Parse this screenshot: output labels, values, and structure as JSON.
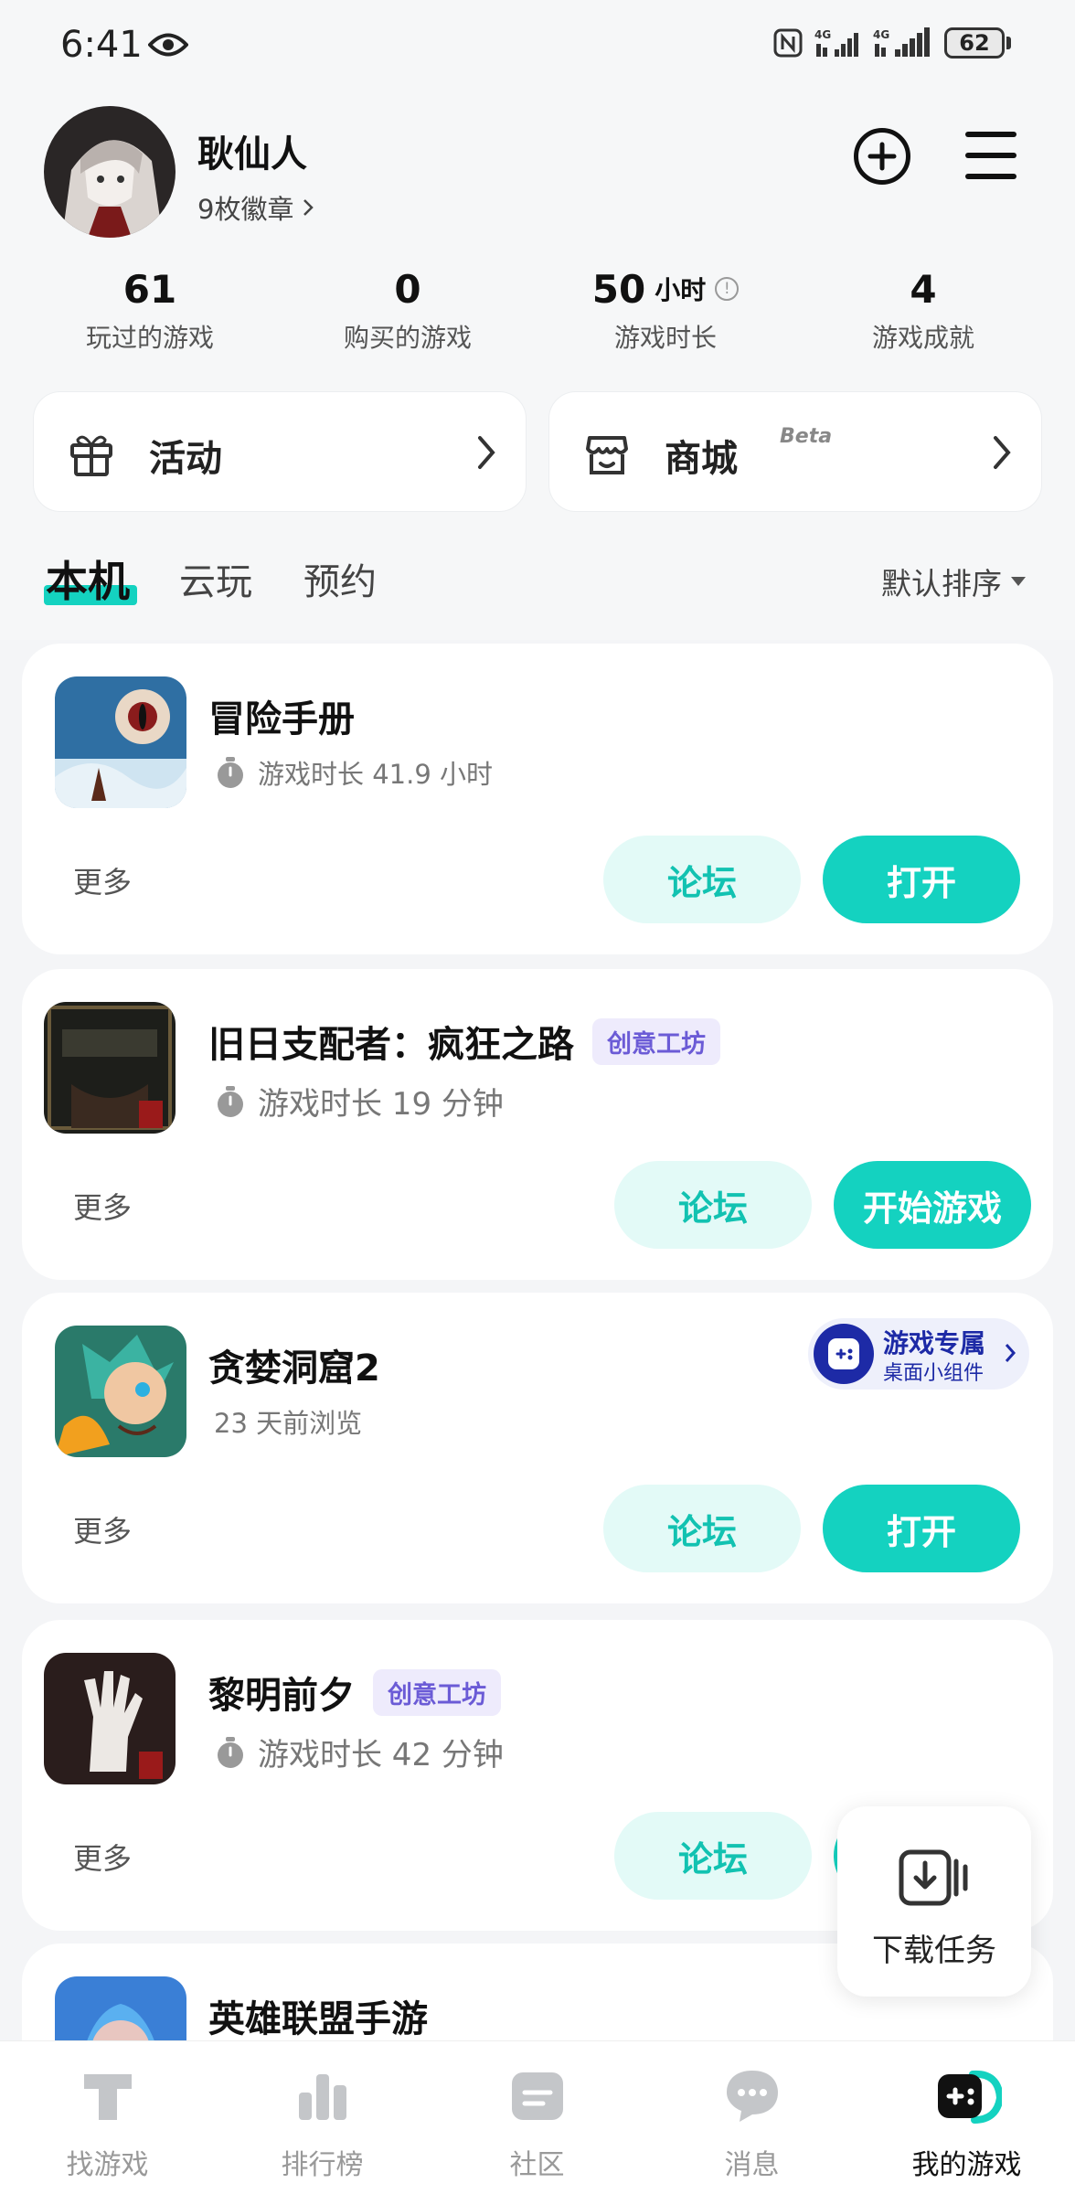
{
  "status_bar": {
    "time": "6:41",
    "battery": "62",
    "network_label": "4G"
  },
  "profile": {
    "username": "耿仙人",
    "badges": "9枚徽章"
  },
  "stats": [
    {
      "value": "61",
      "unit": "",
      "label": "玩过的游戏"
    },
    {
      "value": "0",
      "unit": "",
      "label": "购买的游戏"
    },
    {
      "value": "50",
      "unit": "小时",
      "label": "游戏时长"
    },
    {
      "value": "4",
      "unit": "",
      "label": "游戏成就"
    }
  ],
  "quick": {
    "activity": "活动",
    "store": "商城",
    "beta": "Beta"
  },
  "tabs": [
    "本机",
    "云玩",
    "预约"
  ],
  "sort": "默认排序",
  "games": [
    {
      "title": "冒险手册",
      "tag": "",
      "sub": "游戏时长 41.9 小时",
      "more": "更多",
      "forum": "论坛",
      "action": "打开"
    },
    {
      "title": "旧日支配者：疯狂之路",
      "tag": "创意工坊",
      "sub": "游戏时长 19 分钟",
      "more": "更多",
      "forum": "论坛",
      "action": "开始游戏"
    },
    {
      "title": "贪婪洞窟2",
      "tag": "",
      "sub": "23 天前浏览",
      "more": "更多",
      "forum": "论坛",
      "action": "打开",
      "promo": {
        "title": "游戏专属",
        "sub": "桌面小组件"
      }
    },
    {
      "title": "黎明前夕",
      "tag": "创意工坊",
      "sub": "游戏时长 42 分钟",
      "more": "更多",
      "forum": "论坛",
      "action": ""
    },
    {
      "title": "英雄联盟手游",
      "tag": "",
      "sub": "",
      "more": "",
      "forum": "",
      "action": ""
    }
  ],
  "download_float": {
    "label": "下载任务"
  },
  "bottom_nav": [
    {
      "label": "找游戏",
      "icon": "find-game-icon"
    },
    {
      "label": "排行榜",
      "icon": "ranking-icon"
    },
    {
      "label": "社区",
      "icon": "community-icon"
    },
    {
      "label": "消息",
      "icon": "message-icon"
    },
    {
      "label": "我的游戏",
      "icon": "my-games-icon"
    }
  ],
  "colors": {
    "accent": "#14d2c0",
    "accent_light": "#e3faf7",
    "tag_purple": "#6b5bd6",
    "promo_blue": "#1d2aa6"
  }
}
